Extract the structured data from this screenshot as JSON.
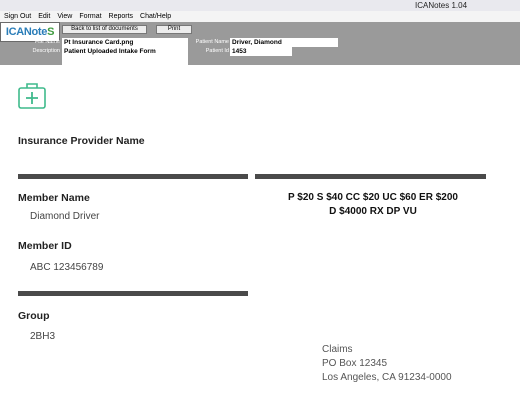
{
  "window": {
    "title": "ICANotes 1.04"
  },
  "menu": [
    "Sign Out",
    "Edit",
    "View",
    "Format",
    "Reports",
    "Chat/Help"
  ],
  "header": {
    "logo": {
      "part1": "ICANote",
      "part2": "S"
    },
    "back_button": "Back to list of documents",
    "print_button": "Print",
    "file_name_label": "File Name",
    "file_name": "Pt Insurance Card.png",
    "description_label": "Description",
    "description": "Patient Uploaded Intake Form",
    "patient_name_label": "Patient Name",
    "patient_name": "Driver, Diamond",
    "patient_id_label": "Patient Id",
    "patient_id": "1453"
  },
  "card": {
    "icon": "medical-kit-icon",
    "icon_color": "#3fba8c",
    "provider": "Insurance Provider Name",
    "member_name_label": "Member Name",
    "member_name": "Diamond Driver",
    "member_id_label": "Member ID",
    "member_id": "ABC 123456789",
    "group_label": "Group",
    "group": "2BH3",
    "copay_line1": "P $20 S $40 CC $20 UC $60 ER $200",
    "copay_line2": "D $4000 RX DP VU",
    "claims_line1": "Claims",
    "claims_line2": "PO Box 12345",
    "claims_line3": "Los Angeles, CA 91234-0000"
  }
}
